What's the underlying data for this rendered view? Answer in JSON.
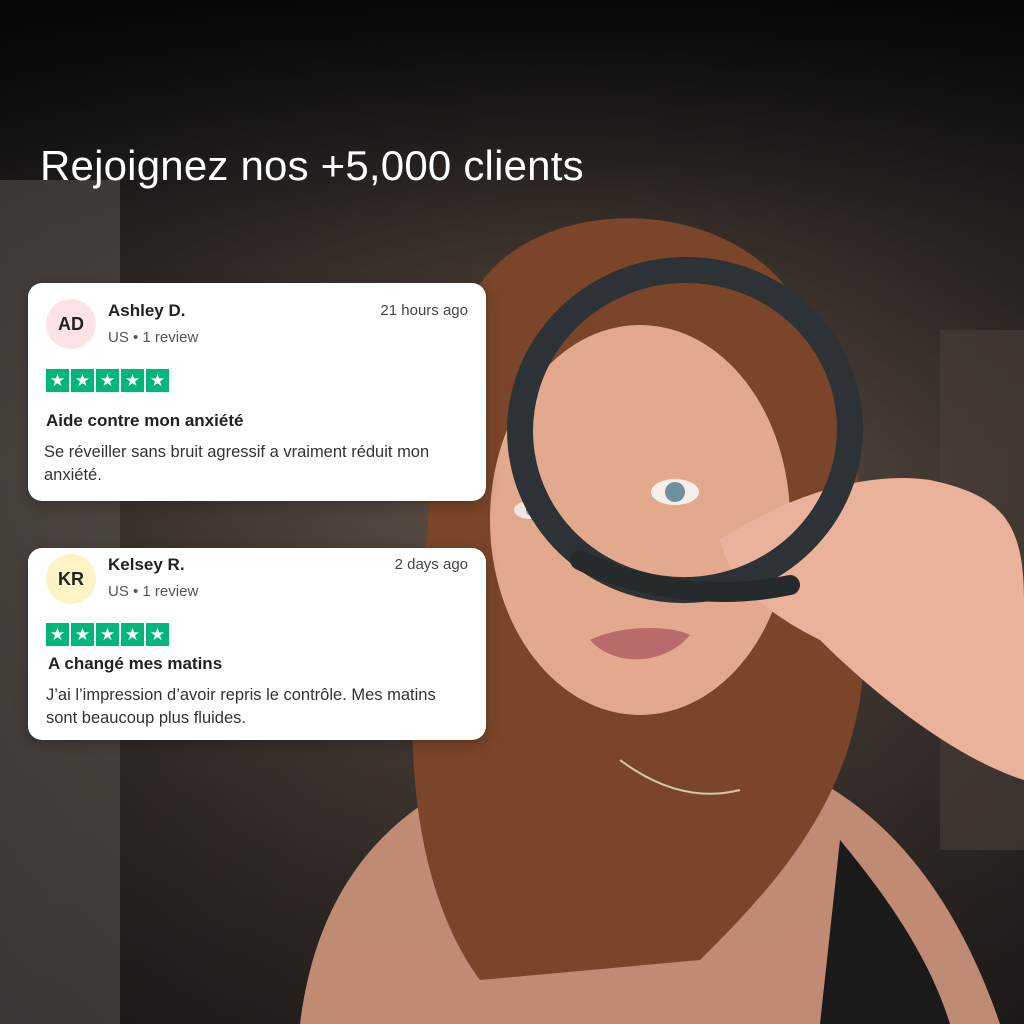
{
  "headline": "Rejoignez nos +5,000 clients",
  "reviews": [
    {
      "initials": "AD",
      "name": "Ashley D.",
      "meta": "US • 1 review",
      "time": "21 hours ago",
      "stars": 5,
      "title": "Aide contre mon anxiété",
      "body": "Se réveiller sans bruit agressif a vraiment réduit mon anxiété.",
      "avatar_color": "#fde3e6"
    },
    {
      "initials": "KR",
      "name": "Kelsey R.",
      "meta": "US • 1 review",
      "time": "2 days ago",
      "stars": 5,
      "title": "A changé mes matins",
      "body": "J’ai l’impression d’avoir repris le contrôle. Mes matins sont beaucoup plus fluides.",
      "avatar_color": "#fdf4c5"
    }
  ],
  "colors": {
    "star_green": "#00b67a",
    "headline": "#ffffff",
    "card_bg": "#ffffff"
  },
  "icons": {
    "star": "star-icon"
  }
}
